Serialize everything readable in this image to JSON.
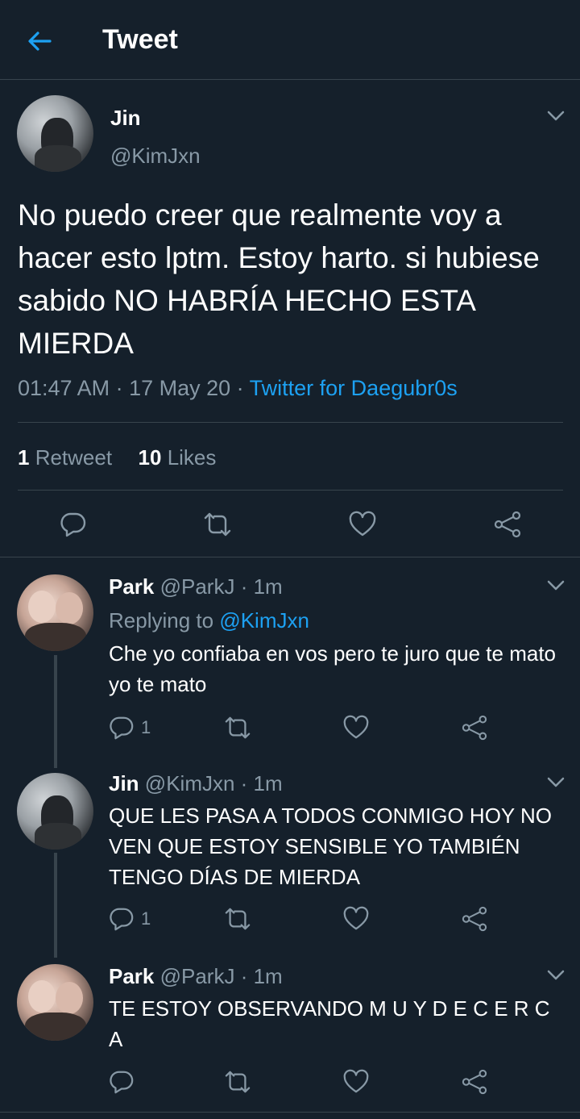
{
  "header": {
    "title": "Tweet",
    "back_icon": "arrow-left-icon",
    "accent": "#1da1f2"
  },
  "main_tweet": {
    "name": "Jin",
    "handle": "@KimJxn",
    "text": "No puedo creer que realmente voy a hacer esto lptm. Estoy harto. si hubiese sabido NO HABRÍA HECHO ESTA MIERDA",
    "time": "01:47 AM · 17 May 20 · ",
    "source": "Twitter for Daegubr0s",
    "retweets_count": "1",
    "retweets_label": " Retweet",
    "likes_count": "10",
    "likes_label": " Likes"
  },
  "replies": [
    {
      "name": "Park",
      "meta": " @ParkJ · 1m",
      "replying_prefix": "Replying to ",
      "replying_handle": "@KimJxn",
      "text": "Che yo confiaba en vos pero te juro que te mato yo te mato",
      "reply_count": "1"
    },
    {
      "name": "Jin",
      "meta": " @KimJxn · 1m",
      "text": "QUE LES PASA A TODOS CONMIGO HOY NO VEN QUE ESTOY SENSIBLE YO TAMBIÉN TENGO DÍAS DE MIERDA",
      "reply_count": "1"
    },
    {
      "name": "Park",
      "meta": " @ParkJ · 1m",
      "text": "TE ESTOY OBSERVANDO M U Y D E C E R C A",
      "reply_count": ""
    }
  ],
  "colors": {
    "background": "#15202b",
    "divider": "#38444d",
    "muted": "#8899a6",
    "link": "#1da1f2"
  }
}
